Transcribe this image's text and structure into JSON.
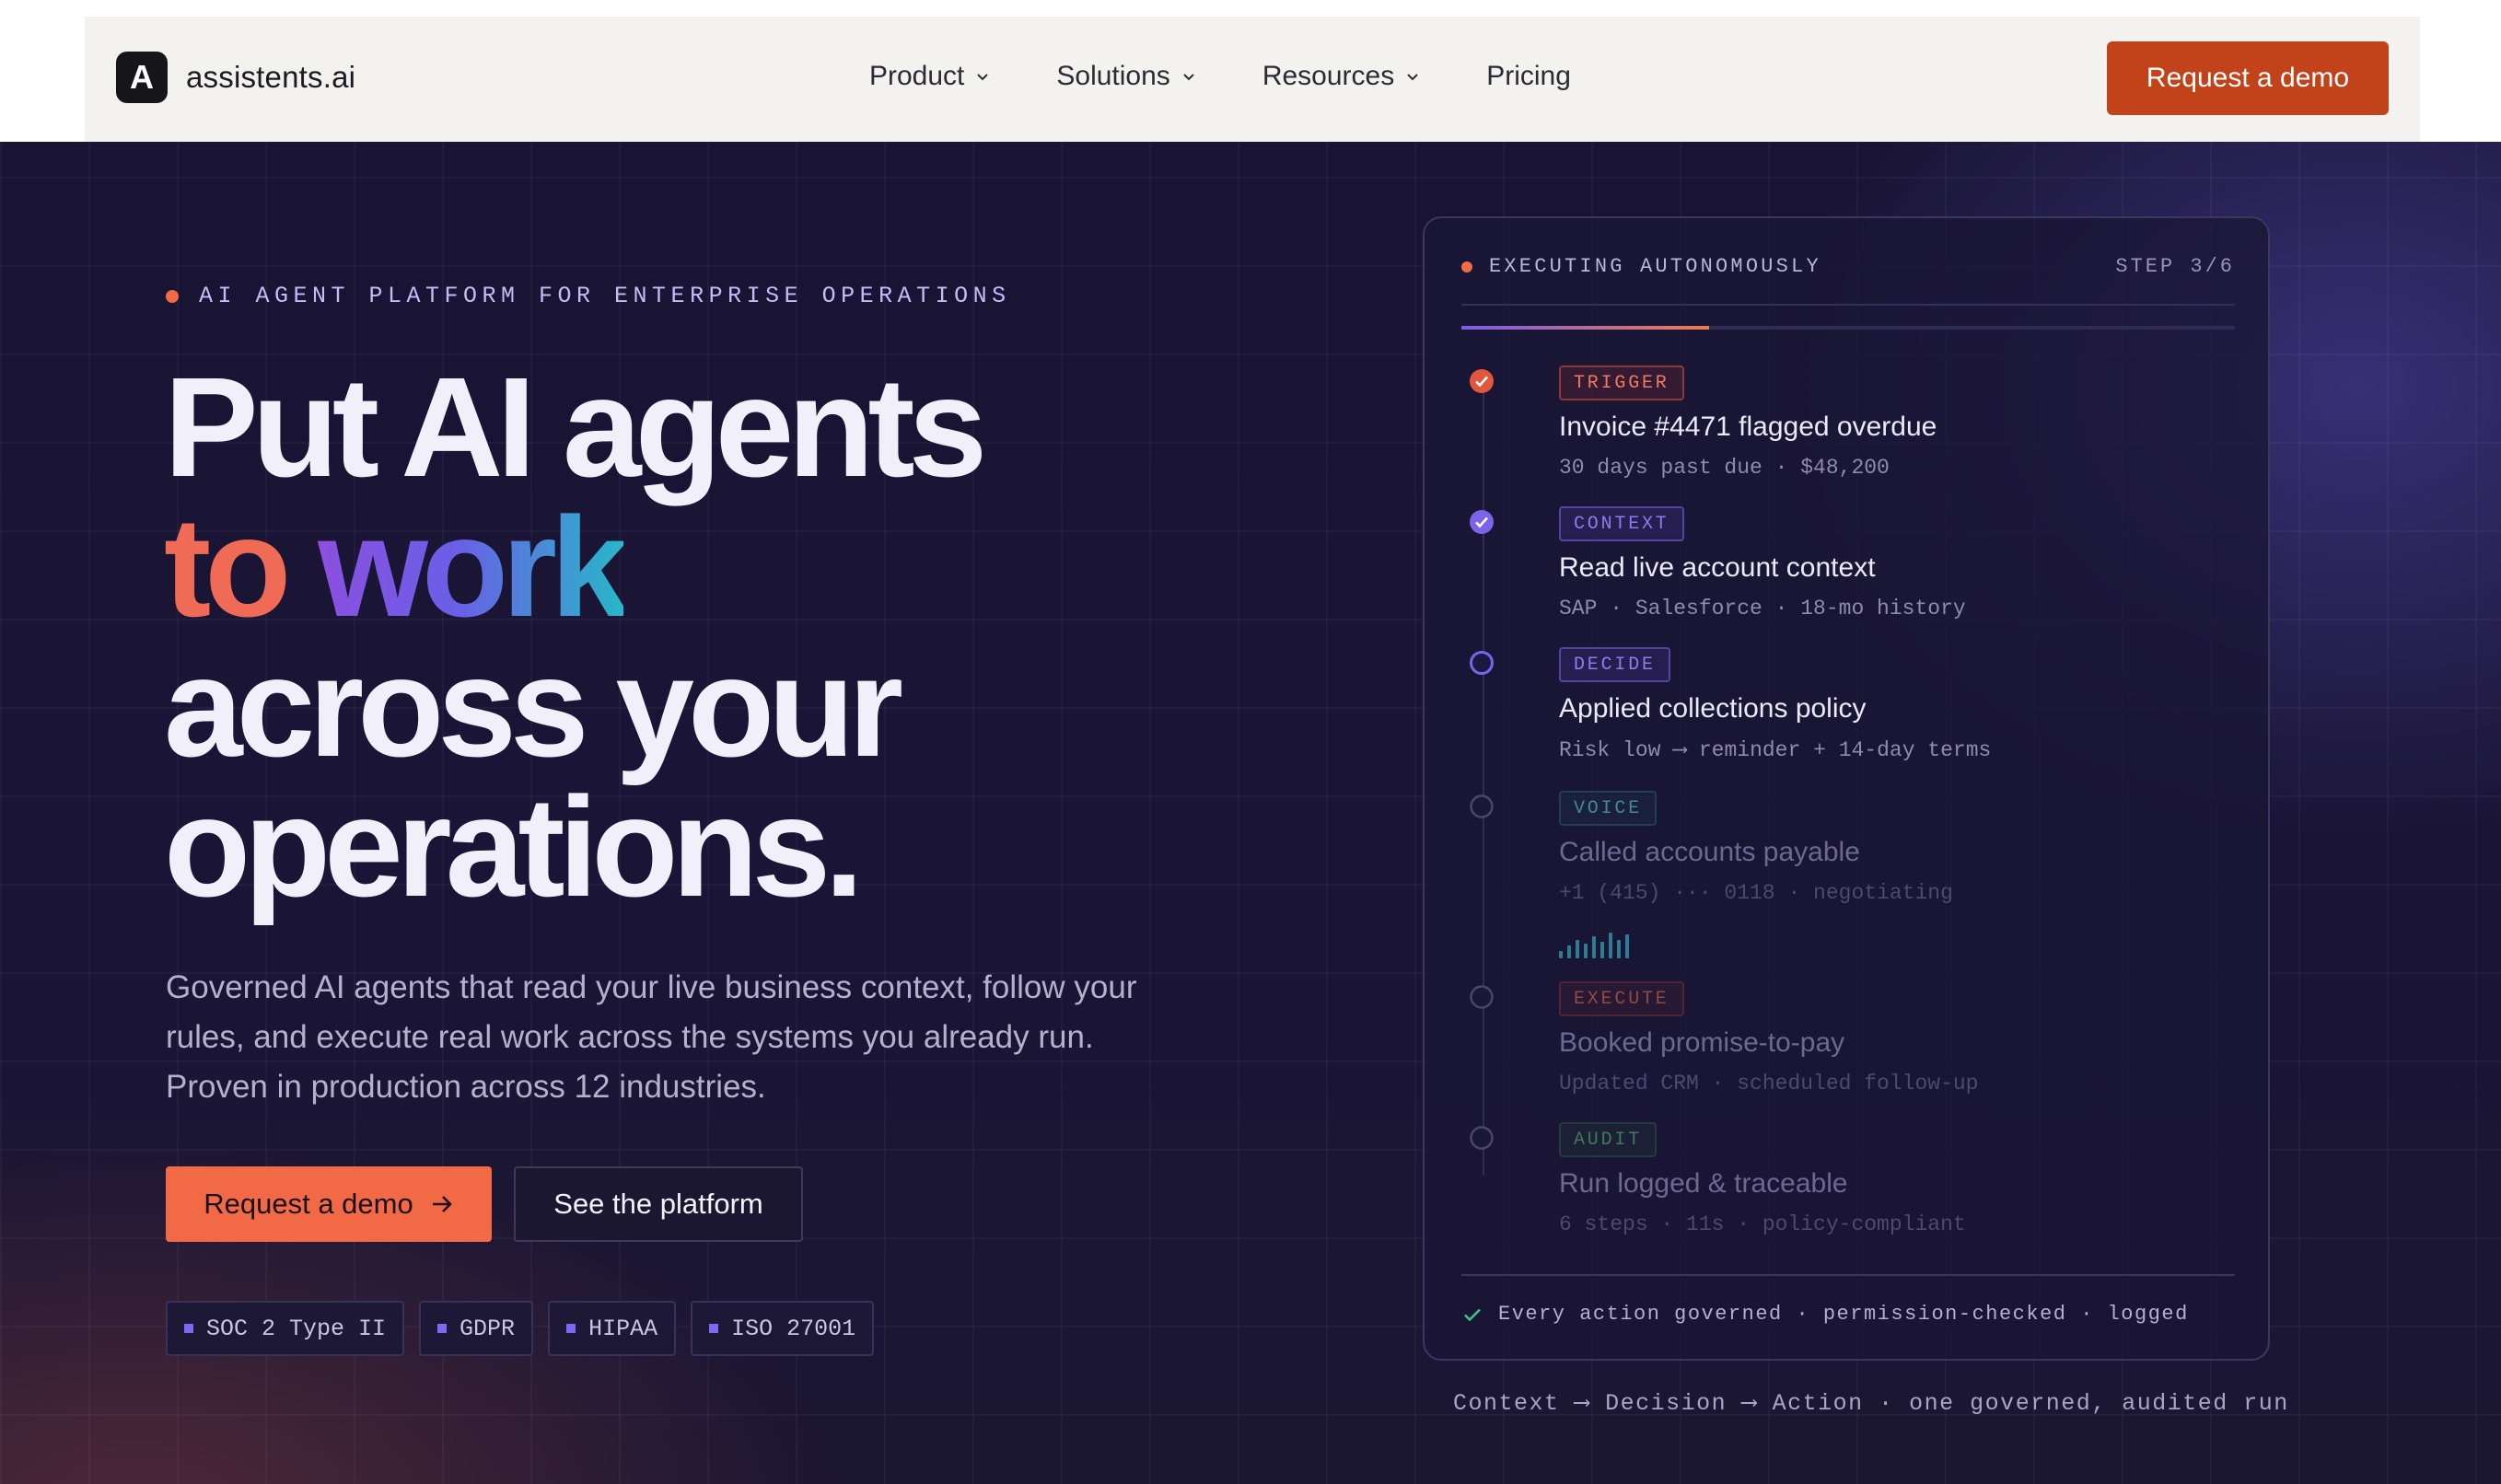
{
  "brand": {
    "logo_letter": "A",
    "name": "assistents.ai"
  },
  "nav": {
    "links": [
      {
        "label": "Product",
        "has_dropdown": true
      },
      {
        "label": "Solutions",
        "has_dropdown": true
      },
      {
        "label": "Resources",
        "has_dropdown": true
      },
      {
        "label": "Pricing",
        "has_dropdown": false
      }
    ],
    "cta_label": "Request a demo"
  },
  "hero": {
    "eyebrow": "AI AGENT PLATFORM FOR ENTERPRISE OPERATIONS",
    "headline": {
      "line1": "Put AI agents",
      "line2_word1": "to",
      "line2_word2": "work",
      "line3": "across your",
      "line4": "operations."
    },
    "lede": "Governed AI agents that read your live business context, follow your rules, and execute real work across the systems you already run. Proven in production across 12 industries.",
    "primary_cta": "Request a demo",
    "primary_cta_icon": "arrow-right-icon",
    "secondary_cta": "See the platform",
    "badges": [
      "SOC 2 Type II",
      "GDPR",
      "HIPAA",
      "ISO 27001"
    ]
  },
  "panel": {
    "status": "EXECUTING AUTONOMOUSLY",
    "step": "STEP 3/6",
    "progress_fraction": 0.32,
    "steps": [
      {
        "tag": "TRIGGER",
        "title": "Invoice #4471 flagged overdue",
        "meta": "30 days past due · $48,200",
        "state": "done",
        "color": "#e2573b"
      },
      {
        "tag": "CONTEXT",
        "title": "Read live account context",
        "meta": "SAP · Salesforce · 18-mo history",
        "state": "done",
        "color": "#7a65ea"
      },
      {
        "tag": "DECIDE",
        "title": "Applied collections policy",
        "meta": "Risk low ⟶ reminder + 14-day terms",
        "state": "active",
        "color": "#7a65ea"
      },
      {
        "tag": "VOICE",
        "title": "Called accounts payable",
        "meta": "+1 (415) ··· 0118 · negotiating",
        "state": "pending"
      },
      {
        "tag": "EXECUTE",
        "title": "Booked promise-to-pay",
        "meta": "Updated CRM · scheduled follow-up",
        "state": "pending"
      },
      {
        "tag": "AUDIT",
        "title": "Run logged & traceable",
        "meta": "6 steps · 11s · policy-compliant",
        "state": "pending"
      }
    ],
    "footer": "Every action governed · permission-checked · logged",
    "footer_icon": "check-icon"
  },
  "caption": "Context ⟶ Decision ⟶ Action · one governed, audited run",
  "colors": {
    "accent_orange": "#f26a45",
    "nav_cta": "#c2431a",
    "accent_purple": "#7a65ea"
  }
}
